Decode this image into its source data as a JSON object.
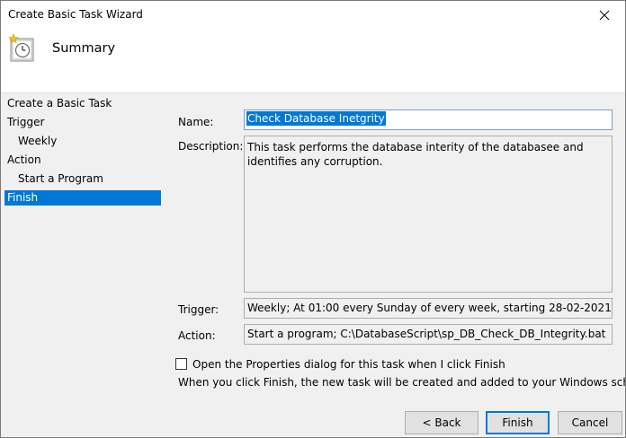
{
  "window": {
    "title": "Create Basic Task Wizard"
  },
  "header": {
    "title": "Summary",
    "icon": "task-clock-icon"
  },
  "nav": {
    "items": [
      {
        "label": "Create a Basic Task",
        "level": 0,
        "selected": false
      },
      {
        "label": "Trigger",
        "level": 0,
        "selected": false
      },
      {
        "label": "Weekly",
        "level": 1,
        "selected": false
      },
      {
        "label": "Action",
        "level": 0,
        "selected": false
      },
      {
        "label": "Start a Program",
        "level": 1,
        "selected": false
      },
      {
        "label": "Finish",
        "level": 0,
        "selected": true
      }
    ]
  },
  "form": {
    "name_label": "Name:",
    "name_value": "Check Database Inetgrity",
    "description_label": "Description:",
    "description_value": "This task performs the database interity of the databasee and identifies any corruption.",
    "trigger_label": "Trigger:",
    "trigger_value": "Weekly; At 01:00 every Sunday of every week, starting 28-02-2021",
    "action_label": "Action:",
    "action_value": "Start a program; C:\\DatabaseScript\\sp_DB_Check_DB_Integrity.bat"
  },
  "footer": {
    "checkbox_label": "Open the Properties dialog for this task when I click Finish",
    "checkbox_checked": false,
    "info_text": "When you click Finish, the new task will be created and added to your Windows schedule.",
    "back_label": "< Back",
    "finish_label": "Finish",
    "cancel_label": "Cancel"
  },
  "colors": {
    "accent": "#0078d7",
    "dialog_background": "#f0f0f0"
  }
}
